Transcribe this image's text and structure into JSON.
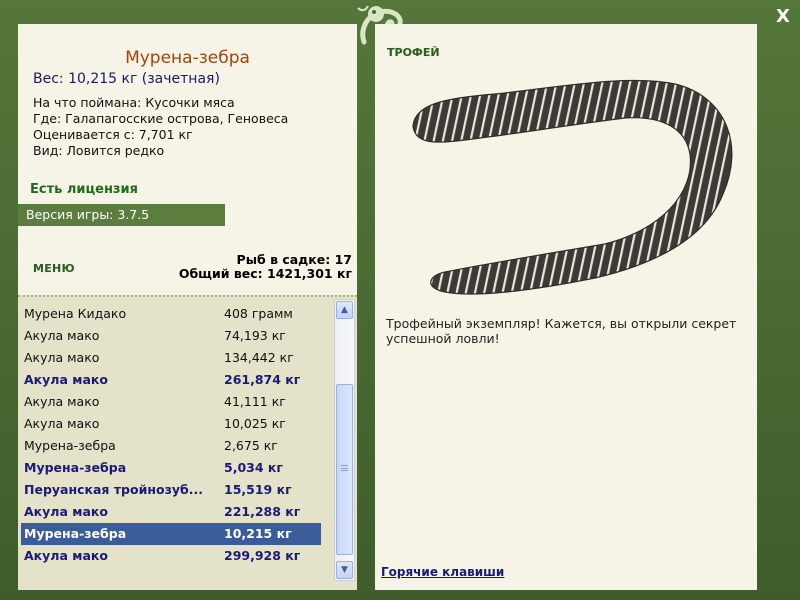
{
  "window": {
    "close_label": "X"
  },
  "fish": {
    "title": "Мурена-зебра",
    "weight": "Вес: 10,215 кг (зачетная)",
    "info": [
      "На что поймана: Кусочки мяса",
      "Где: Галапагосские острова, Геновеса",
      "Оценивается с: 7,701 кг",
      "Вид: Ловится редко"
    ],
    "license": "Есть лицензия"
  },
  "version": "Версия игры: 3.7.5",
  "menu_label": "МЕНЮ",
  "stats": {
    "count": "Рыб в садке: 17",
    "total": "Общий вес: 1421,301 кг"
  },
  "catch_list": [
    {
      "name": "Мурена Кидако",
      "weight": "408 грамм",
      "bold": false
    },
    {
      "name": "Акула мако",
      "weight": "74,193 кг",
      "bold": false
    },
    {
      "name": "Акула мако",
      "weight": "134,442 кг",
      "bold": false
    },
    {
      "name": "Акула мако",
      "weight": "261,874 кг",
      "bold": true
    },
    {
      "name": "Акула мако",
      "weight": "41,111 кг",
      "bold": false
    },
    {
      "name": "Акула мако",
      "weight": "10,025 кг",
      "bold": false
    },
    {
      "name": "Мурена-зебра",
      "weight": "2,675 кг",
      "bold": false
    },
    {
      "name": "Мурена-зебра",
      "weight": "5,034 кг",
      "bold": true
    },
    {
      "name": "Перуанская тройнозуб...",
      "weight": "15,519 кг",
      "bold": true
    },
    {
      "name": "Акула мако",
      "weight": "221,288 кг",
      "bold": true
    },
    {
      "name": "Мурена-зебра",
      "weight": "10,215 кг",
      "bold": true,
      "selected": true
    },
    {
      "name": "Акула мако",
      "weight": "299,928 кг",
      "bold": true
    }
  ],
  "scroll": {
    "up_icon": "scroll-up-arrow",
    "down_icon": "scroll-down-arrow"
  },
  "trophy": {
    "label": "ТРОФЕЙ",
    "image_icon": "zebra-moray-eel",
    "text": "Трофейный экземпляр! Кажется, вы открыли секрет успешной ловли!"
  },
  "hotkeys": "Горячие клавиши",
  "colors": {
    "frame": "#4a6a34",
    "panel": "#f6f4e6",
    "list_bg": "#e4e2c8",
    "selected": "#3a5d9a",
    "title": "#a24411"
  }
}
